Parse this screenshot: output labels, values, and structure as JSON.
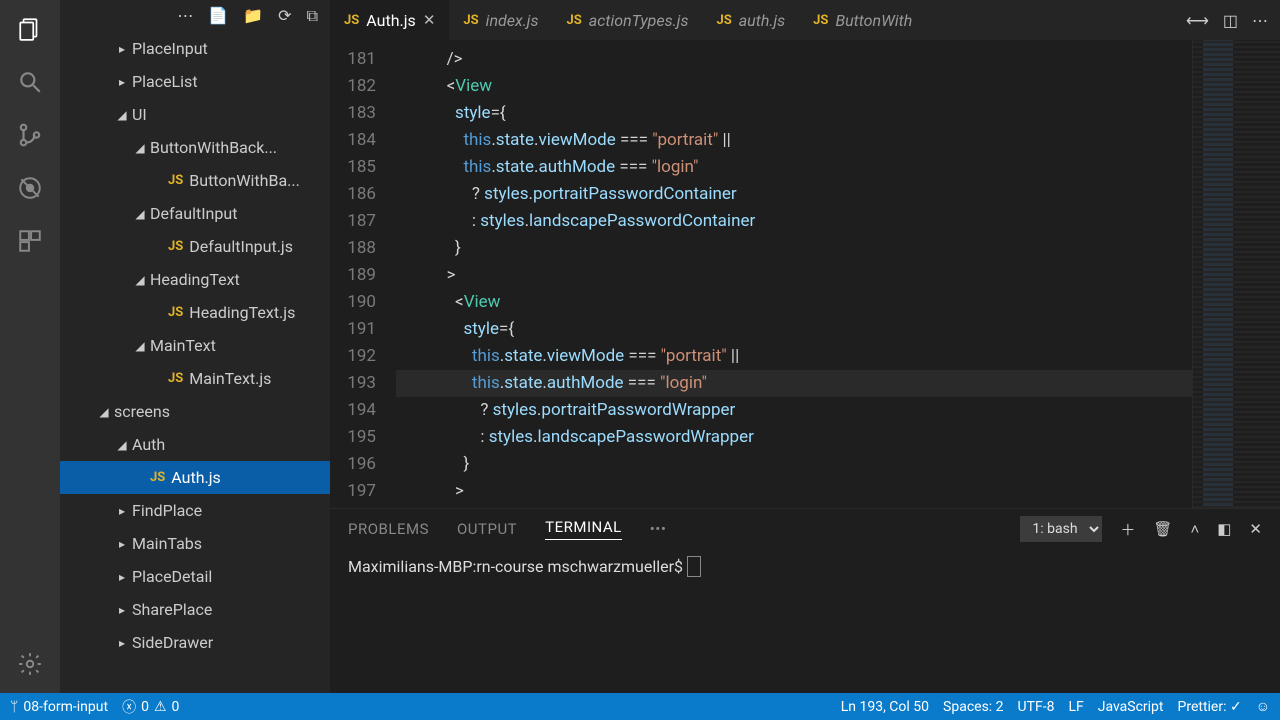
{
  "tabs": [
    {
      "name": "Auth.js",
      "active": true,
      "close": true
    },
    {
      "name": "index.js",
      "pinned": true
    },
    {
      "name": "actionTypes.js",
      "pinned": true
    },
    {
      "name": "auth.js",
      "pinned": true
    },
    {
      "name": "ButtonWith",
      "pinned": true
    }
  ],
  "sidebarTree": [
    {
      "indent": 2,
      "twist": "▸",
      "label": "PlaceInput"
    },
    {
      "indent": 2,
      "twist": "▸",
      "label": "PlaceList"
    },
    {
      "indent": 2,
      "twist": "◢",
      "label": "UI"
    },
    {
      "indent": 3,
      "twist": "◢",
      "label": "ButtonWithBack..."
    },
    {
      "indent": 4,
      "js": true,
      "label": "ButtonWithBa..."
    },
    {
      "indent": 3,
      "twist": "◢",
      "label": "DefaultInput"
    },
    {
      "indent": 4,
      "js": true,
      "label": "DefaultInput.js"
    },
    {
      "indent": 3,
      "twist": "◢",
      "label": "HeadingText"
    },
    {
      "indent": 4,
      "js": true,
      "label": "HeadingText.js"
    },
    {
      "indent": 3,
      "twist": "◢",
      "label": "MainText"
    },
    {
      "indent": 4,
      "js": true,
      "label": "MainText.js"
    },
    {
      "indent": 1,
      "twist": "◢",
      "label": "screens"
    },
    {
      "indent": 2,
      "twist": "◢",
      "label": "Auth"
    },
    {
      "indent": 3,
      "js": true,
      "label": "Auth.js",
      "sel": true
    },
    {
      "indent": 2,
      "twist": "▸",
      "label": "FindPlace"
    },
    {
      "indent": 2,
      "twist": "▸",
      "label": "MainTabs"
    },
    {
      "indent": 2,
      "twist": "▸",
      "label": "PlaceDetail"
    },
    {
      "indent": 2,
      "twist": "▸",
      "label": "SharePlace"
    },
    {
      "indent": 2,
      "twist": "▸",
      "label": "SideDrawer"
    }
  ],
  "code": {
    "start": 181,
    "current": 193,
    "lines": [
      [
        {
          "t": "            ",
          "c": ""
        },
        {
          "t": "/>",
          "c": "c-punc"
        }
      ],
      [
        {
          "t": "            ",
          "c": ""
        },
        {
          "t": "<",
          "c": "c-punc"
        },
        {
          "t": "View",
          "c": "c-tag"
        }
      ],
      [
        {
          "t": "              ",
          "c": ""
        },
        {
          "t": "style",
          "c": "c-attr"
        },
        {
          "t": "={",
          "c": "c-punc"
        }
      ],
      [
        {
          "t": "                ",
          "c": ""
        },
        {
          "t": "this",
          "c": "c-this"
        },
        {
          "t": ".",
          "c": "c-punc"
        },
        {
          "t": "state",
          "c": "c-prop"
        },
        {
          "t": ".",
          "c": "c-punc"
        },
        {
          "t": "viewMode",
          "c": "c-prop"
        },
        {
          "t": " === ",
          "c": "c-op"
        },
        {
          "t": "\"portrait\"",
          "c": "c-str"
        },
        {
          "t": " ||",
          "c": "c-op"
        }
      ],
      [
        {
          "t": "                ",
          "c": ""
        },
        {
          "t": "this",
          "c": "c-this"
        },
        {
          "t": ".",
          "c": "c-punc"
        },
        {
          "t": "state",
          "c": "c-prop"
        },
        {
          "t": ".",
          "c": "c-punc"
        },
        {
          "t": "authMode",
          "c": "c-prop"
        },
        {
          "t": " === ",
          "c": "c-op"
        },
        {
          "t": "\"login\"",
          "c": "c-str"
        }
      ],
      [
        {
          "t": "                  ",
          "c": ""
        },
        {
          "t": "? ",
          "c": "c-op"
        },
        {
          "t": "styles",
          "c": "c-prop"
        },
        {
          "t": ".",
          "c": "c-punc"
        },
        {
          "t": "portraitPasswordContainer",
          "c": "c-prop"
        }
      ],
      [
        {
          "t": "                  ",
          "c": ""
        },
        {
          "t": ": ",
          "c": "c-op"
        },
        {
          "t": "styles",
          "c": "c-prop"
        },
        {
          "t": ".",
          "c": "c-punc"
        },
        {
          "t": "landscapePasswordContainer",
          "c": "c-prop"
        }
      ],
      [
        {
          "t": "              ",
          "c": ""
        },
        {
          "t": "}",
          "c": "c-punc"
        }
      ],
      [
        {
          "t": "            ",
          "c": ""
        },
        {
          "t": ">",
          "c": "c-punc"
        }
      ],
      [
        {
          "t": "              ",
          "c": ""
        },
        {
          "t": "<",
          "c": "c-punc"
        },
        {
          "t": "View",
          "c": "c-tag"
        }
      ],
      [
        {
          "t": "                ",
          "c": ""
        },
        {
          "t": "style",
          "c": "c-attr"
        },
        {
          "t": "={",
          "c": "c-punc"
        }
      ],
      [
        {
          "t": "                  ",
          "c": ""
        },
        {
          "t": "this",
          "c": "c-this"
        },
        {
          "t": ".",
          "c": "c-punc"
        },
        {
          "t": "state",
          "c": "c-prop"
        },
        {
          "t": ".",
          "c": "c-punc"
        },
        {
          "t": "viewMode",
          "c": "c-prop"
        },
        {
          "t": " === ",
          "c": "c-op"
        },
        {
          "t": "\"portrait\"",
          "c": "c-str"
        },
        {
          "t": " ||",
          "c": "c-op"
        }
      ],
      [
        {
          "t": "                  ",
          "c": ""
        },
        {
          "t": "this",
          "c": "c-this"
        },
        {
          "t": ".",
          "c": "c-punc"
        },
        {
          "t": "state",
          "c": "c-prop"
        },
        {
          "t": ".",
          "c": "c-punc"
        },
        {
          "t": "authMode",
          "c": "c-prop"
        },
        {
          "t": " === ",
          "c": "c-op"
        },
        {
          "t": "\"login\"",
          "c": "c-str"
        }
      ],
      [
        {
          "t": "                    ",
          "c": ""
        },
        {
          "t": "? ",
          "c": "c-op"
        },
        {
          "t": "styles",
          "c": "c-prop"
        },
        {
          "t": ".",
          "c": "c-punc"
        },
        {
          "t": "portraitPasswordWrapper",
          "c": "c-prop"
        }
      ],
      [
        {
          "t": "                    ",
          "c": ""
        },
        {
          "t": ": ",
          "c": "c-op"
        },
        {
          "t": "styles",
          "c": "c-prop"
        },
        {
          "t": ".",
          "c": "c-punc"
        },
        {
          "t": "landscapePasswordWrapper",
          "c": "c-prop"
        }
      ],
      [
        {
          "t": "                ",
          "c": ""
        },
        {
          "t": "}",
          "c": "c-punc"
        }
      ],
      [
        {
          "t": "              ",
          "c": ""
        },
        {
          "t": ">",
          "c": "c-punc"
        }
      ]
    ]
  },
  "panel": {
    "tabs": [
      "PROBLEMS",
      "OUTPUT",
      "TERMINAL"
    ],
    "active": "TERMINAL",
    "termSelect": "1: bash",
    "prompt": "Maximilians-MBP:rn-course mschwarzmueller$ "
  },
  "status": {
    "branch": "08-form-input",
    "errors": "0",
    "warnings": "0",
    "pos": "Ln 193, Col 50",
    "spaces": "Spaces: 2",
    "enc": "UTF-8",
    "eol": "LF",
    "lang": "JavaScript",
    "prettier": "Prettier: ✓"
  }
}
